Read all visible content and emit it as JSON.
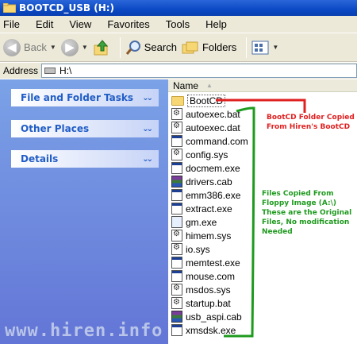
{
  "window": {
    "title": "BOOTCD_USB (H:)"
  },
  "menu": [
    "File",
    "Edit",
    "View",
    "Favorites",
    "Tools",
    "Help"
  ],
  "toolbar": {
    "back": "Back",
    "search": "Search",
    "folders": "Folders"
  },
  "address": {
    "label": "Address",
    "value": "H:\\"
  },
  "tasks": [
    {
      "label": "File and Folder Tasks"
    },
    {
      "label": "Other Places"
    },
    {
      "label": "Details"
    }
  ],
  "list": {
    "column": "Name"
  },
  "files": [
    {
      "name": "BootCD",
      "icon": "folder-icon"
    },
    {
      "name": "autoexec.bat",
      "icon": "batch-file-icon"
    },
    {
      "name": "autoexec.dat",
      "icon": "system-file-icon"
    },
    {
      "name": "command.com",
      "icon": "application-icon"
    },
    {
      "name": "config.sys",
      "icon": "system-file-icon"
    },
    {
      "name": "docmem.exe",
      "icon": "application-icon"
    },
    {
      "name": "drivers.cab",
      "icon": "cabinet-file-icon"
    },
    {
      "name": "emm386.exe",
      "icon": "application-icon"
    },
    {
      "name": "extract.exe",
      "icon": "application-icon"
    },
    {
      "name": "gm.exe",
      "icon": "application-icon"
    },
    {
      "name": "himem.sys",
      "icon": "system-file-icon"
    },
    {
      "name": "io.sys",
      "icon": "system-file-icon"
    },
    {
      "name": "memtest.exe",
      "icon": "application-icon"
    },
    {
      "name": "mouse.com",
      "icon": "application-icon"
    },
    {
      "name": "msdos.sys",
      "icon": "system-file-icon"
    },
    {
      "name": "startup.bat",
      "icon": "batch-file-icon"
    },
    {
      "name": "usb_aspi.cab",
      "icon": "cabinet-file-icon"
    },
    {
      "name": "xmsdsk.exe",
      "icon": "application-icon"
    }
  ],
  "annotations": {
    "red": "BootCD Folder Copied From Hiren's BootCD",
    "green": "Files Copied From Floppy Image  (A:\\) These are the Original Files, No modification Needed",
    "red_color": "#e02020",
    "green_color": "#1e9a1e"
  },
  "watermark": "www.hiren.info"
}
